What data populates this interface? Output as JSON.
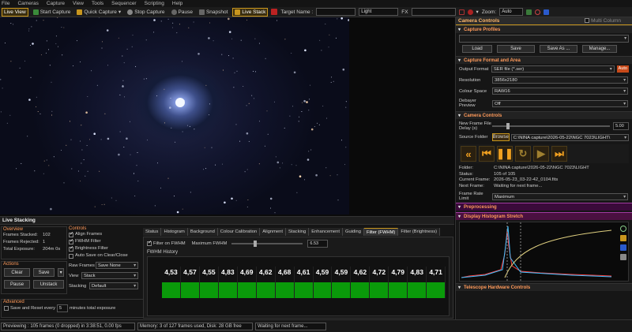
{
  "menu": [
    "File",
    "Cameras",
    "Capture",
    "View",
    "Tools",
    "Sequencer",
    "Scripting",
    "Help"
  ],
  "toolbar": {
    "live_view": "Live View",
    "start_capture": "Start Capture",
    "quick_capture": "Quick Capture",
    "stop_capture": "Stop Capture",
    "pause": "Pause",
    "snapshot": "Snapshot",
    "live_stack": "Live Stack",
    "target_name_label": "Target Name :",
    "target_name_value": "",
    "frame_type": "Light",
    "fx_label": "FX",
    "fx_value": "",
    "zoom_label": "Zoom:",
    "zoom_value": "Auto"
  },
  "camera_controls": {
    "title": "Camera Controls",
    "multi_column": "Multi Column",
    "capture_profiles": {
      "title": "Capture Profiles",
      "load": "Load",
      "save": "Save",
      "save_as": "Save As ...",
      "manage": "Manage..."
    },
    "format": {
      "title": "Capture Format and Area",
      "output_format_label": "Output Format",
      "output_format": "SER file (*.ser)",
      "auto": "Auto",
      "resolution_label": "Resolution",
      "resolution": "3856x2180",
      "colour_space_label": "Colour Space",
      "colour_space": "RAW16",
      "debayer_label": "Debayer Preview",
      "debayer": "Off"
    },
    "controls": {
      "title": "Camera Controls",
      "delay_label": "New Frame File Delay (s)",
      "delay_value": "5.00",
      "source_folder_label": "Source Folder",
      "browse": "Browse",
      "source_folder": "C:\\NINA capture\\2026-05-22\\NGC 7023\\LIGHT\\"
    },
    "status": {
      "folder_label": "Folder:",
      "folder": "C:\\NINA capture\\2026-05-22\\NGC 7023\\LIGHT",
      "status_label": "Status:",
      "status": "105 of 105",
      "current_label": "Current Frame:",
      "current": "2026-05-23_03-22-42_0104.fits",
      "next_label": "Next Frame:",
      "next": "Waiting for next frame..."
    },
    "frame_rate_label": "Frame Rate Limit",
    "frame_rate": "Maximum",
    "preprocessing": "Preprocessing",
    "histogram": "Display Histogram Stretch",
    "telescope": "Telescope Hardware Controls"
  },
  "live_stacking": {
    "title": "Live Stacking",
    "overview": {
      "title": "Overview",
      "frames_stacked_label": "Frames Stacked:",
      "frames_stacked": "102",
      "frames_rejected_label": "Frames Rejected:",
      "frames_rejected": "1",
      "total_exposure_label": "Total Exposure:",
      "total_exposure": "204m 0s"
    },
    "actions": {
      "title": "Actions",
      "clear": "Clear",
      "save": "Save",
      "pause": "Pause",
      "unstack": "Unstack"
    },
    "controls": {
      "title": "Controls",
      "align": "Align Frames",
      "fwhm_filter": "FWHM Filter",
      "brightness": "Brightness Filter",
      "auto_save": "Auto Save on Clear/Close",
      "raw_frames_label": "Raw Frames",
      "raw_frames": "Save None",
      "view_label": "View",
      "view": "Stack",
      "stacking_label": "Stacking",
      "stacking": "Default"
    },
    "advanced": {
      "title": "Advanced",
      "save_reset_label": "Save and Reset every",
      "save_reset_value": "5",
      "save_reset_suffix": "minutes total exposure"
    },
    "tabs": [
      "Status",
      "Histogram",
      "Background",
      "Colour Calibration",
      "Alignment",
      "Stacking",
      "Enhancement",
      "Guiding",
      "Filter (FWHM)",
      "Filter (Brightness)"
    ],
    "active_tab": "Filter (FWHM)",
    "fwhm": {
      "filter_label": "Filter on FWHM",
      "max_label": "Maximum FWHM",
      "max_value": "6.53",
      "history_label": "FWHM History",
      "values": [
        "4,53",
        "4,57",
        "4,55",
        "4,83",
        "4,69",
        "4,62",
        "4,68",
        "4,61",
        "4,59",
        "4,59",
        "4,62",
        "4,72",
        "4,79",
        "4,83",
        "4,71"
      ]
    }
  },
  "statusbar": {
    "preview": "Previewing : 105 frames (0 dropped) in 3:38:51, 0.00 fps",
    "memory": "Memory: 3 of 127 frames used, Disk: 28 GB free",
    "waiting": "Waiting for next frame..."
  },
  "colors": {
    "accent": "#c8961e",
    "orange_text": "#ff9a5a",
    "fwhm_bar": "#0a9a0a",
    "magenta_section": "#6a1a6a"
  }
}
